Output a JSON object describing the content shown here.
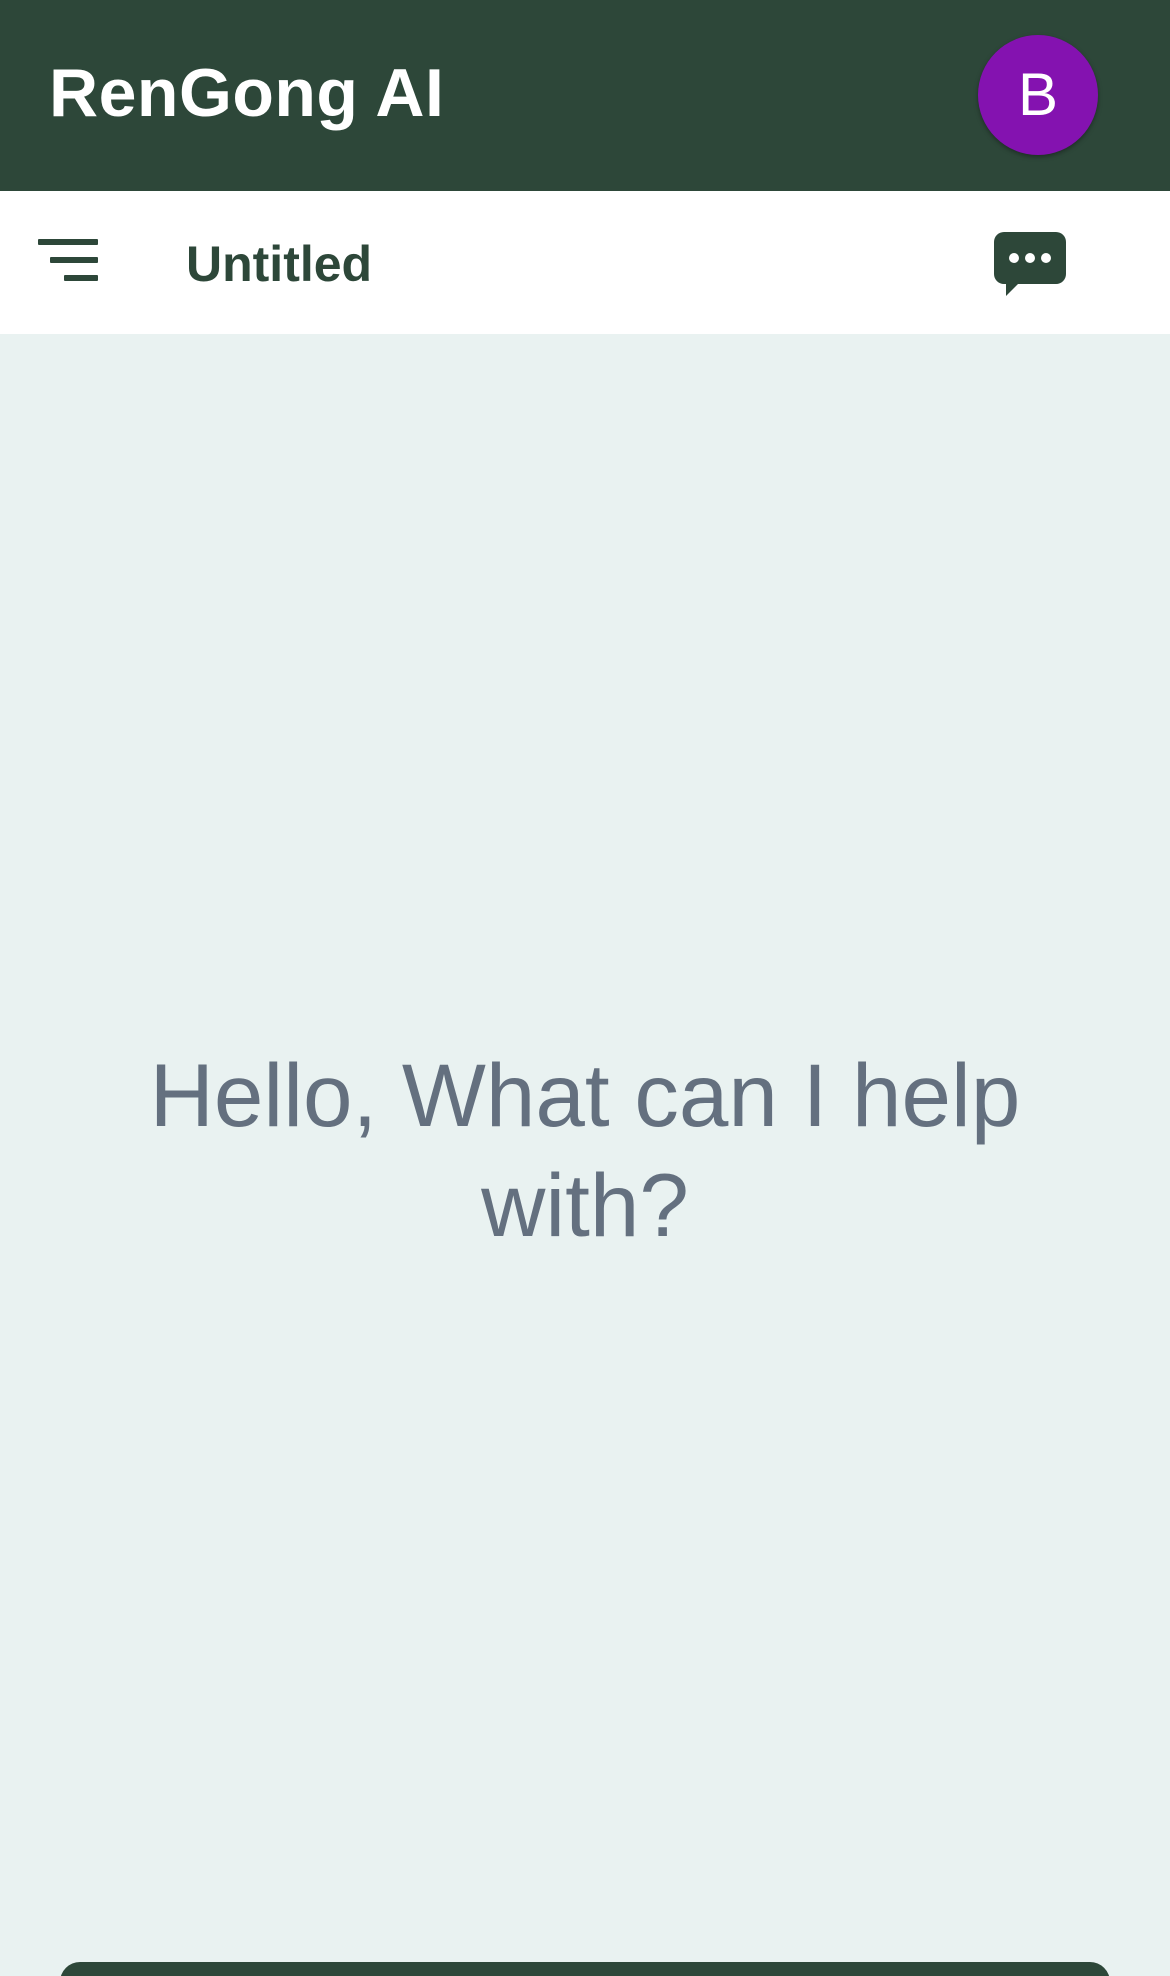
{
  "header": {
    "app_title": "RenGong AI",
    "avatar_initial": "B"
  },
  "toolbar": {
    "menu_icon": "menu-lines-icon",
    "document_title": "Untitled",
    "chat_icon": "chat-bubble-ellipsis-icon"
  },
  "main": {
    "greeting": "Hello, What can I help with?"
  },
  "colors": {
    "header_bg": "#2d4739",
    "avatar_bg": "#8412b0",
    "content_bg": "#e9f2f1",
    "greeting_text": "#64707f"
  }
}
